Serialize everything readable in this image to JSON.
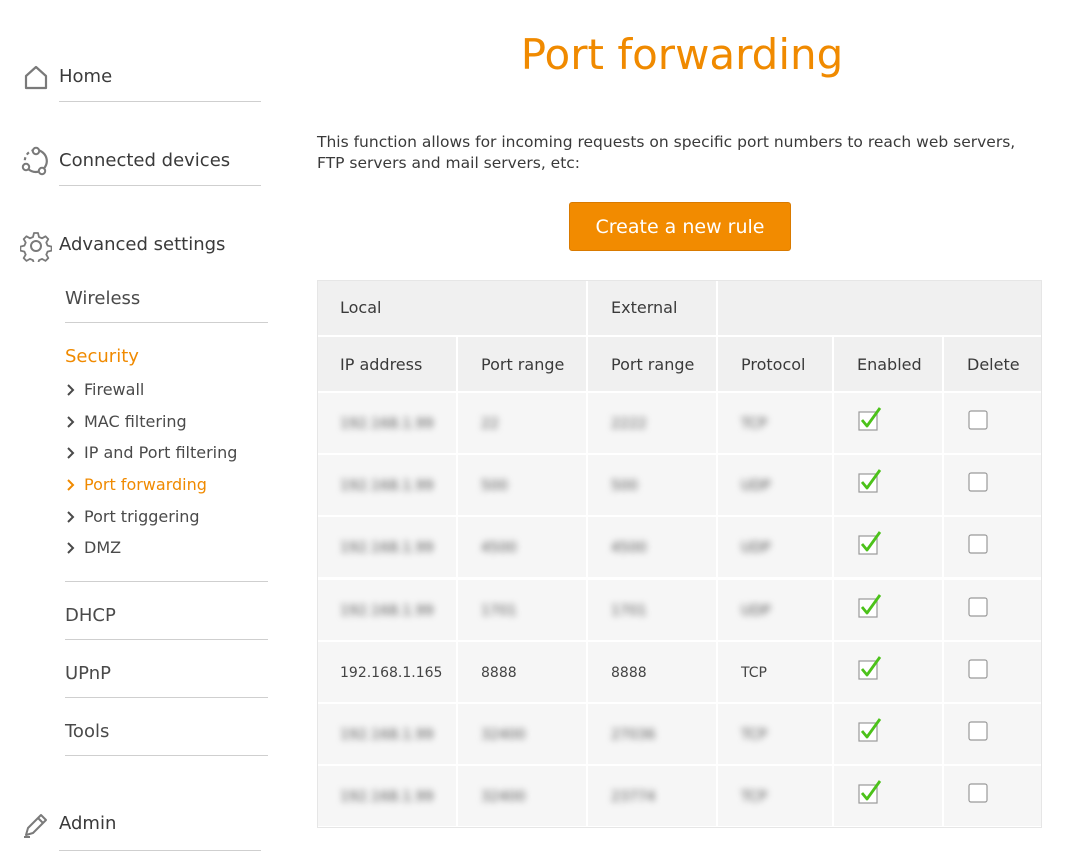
{
  "sidebar": {
    "home": {
      "label": "Home",
      "icon": "home-icon"
    },
    "connected": {
      "label": "Connected devices",
      "icon": "connected-devices-icon"
    },
    "advanced": {
      "label": "Advanced settings",
      "icon": "gear-icon"
    },
    "wireless": "Wireless",
    "security": {
      "title": "Security",
      "items": [
        {
          "label": "Firewall",
          "active": false
        },
        {
          "label": "MAC filtering",
          "active": false
        },
        {
          "label": "IP and Port filtering",
          "active": false
        },
        {
          "label": "Port forwarding",
          "active": true
        },
        {
          "label": "Port triggering",
          "active": false
        },
        {
          "label": "DMZ",
          "active": false
        }
      ]
    },
    "dhcp": "DHCP",
    "upnp": "UPnP",
    "tools": "Tools",
    "admin": {
      "label": "Admin",
      "icon": "pencil-icon"
    }
  },
  "page": {
    "title": "Port forwarding",
    "intro": "This function allows for incoming requests on specific port numbers to reach web servers, FTP servers and mail servers, etc:",
    "create_button": "Create a new rule"
  },
  "table": {
    "group_headers": {
      "local": "Local",
      "external": "External"
    },
    "columns": [
      "IP address",
      "Port range",
      "Port range",
      "Protocol",
      "Enabled",
      "Delete"
    ],
    "rows": [
      {
        "ip": "192.168.1.99",
        "local_port": "22",
        "external_port": "2222",
        "protocol": "TCP",
        "enabled": true,
        "delete": false,
        "redacted": true
      },
      {
        "ip": "192.168.1.99",
        "local_port": "500",
        "external_port": "500",
        "protocol": "UDP",
        "enabled": true,
        "delete": false,
        "redacted": true
      },
      {
        "ip": "192.168.1.99",
        "local_port": "4500",
        "external_port": "4500",
        "protocol": "UDP",
        "enabled": true,
        "delete": false,
        "redacted": true
      },
      {
        "ip": "192.168.1.99",
        "local_port": "1701",
        "external_port": "1701",
        "protocol": "UDP",
        "enabled": true,
        "delete": false,
        "redacted": true
      },
      {
        "ip": "192.168.1.165",
        "local_port": "8888",
        "external_port": "8888",
        "protocol": "TCP",
        "enabled": true,
        "delete": false,
        "redacted": false
      },
      {
        "ip": "192.168.1.99",
        "local_port": "32400",
        "external_port": "27036",
        "protocol": "TCP",
        "enabled": true,
        "delete": false,
        "redacted": true
      },
      {
        "ip": "192.168.1.99",
        "local_port": "32400",
        "external_port": "23774",
        "protocol": "TCP",
        "enabled": true,
        "delete": false,
        "redacted": true
      }
    ]
  },
  "colors": {
    "accent": "#f08a00",
    "button": "#f28b00",
    "check": "#4cc21a"
  }
}
